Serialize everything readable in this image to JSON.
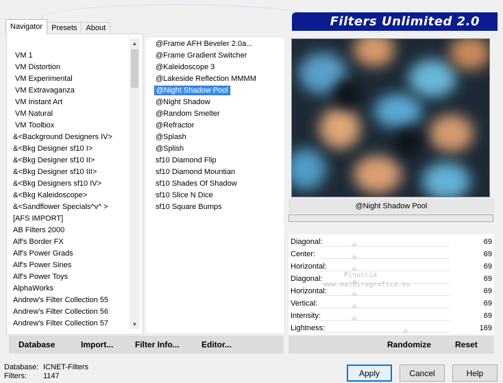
{
  "tabs": [
    {
      "label": "Navigator",
      "active": true
    },
    {
      "label": "Presets",
      "active": false
    },
    {
      "label": "About",
      "active": false
    }
  ],
  "banner_title": "Filters Unlimited 2.0",
  "categories": [
    "VM 1",
    "VM Distortion",
    "VM Experimental",
    "VM Extravaganza",
    "VM Instant Art",
    "VM Natural",
    "VM Toolbox",
    "&<Background Designers IV>",
    "&<Bkg Designer sf10 I>",
    "&<Bkg Designer sf10 II>",
    "&<Bkg Designer sf10 III>",
    "&<Bkg Designers sf10 IV>",
    "&<Bkg Kaleidoscope>",
    "&<Sandflower Specials^v^ >",
    "[AFS IMPORT]",
    "AB Filters 2000",
    "Alf's Border FX",
    "Alf's Power Grads",
    "Alf's Power Sines",
    "Alf's Power Toys",
    "AlphaWorks",
    "Andrew's Filter Collection 55",
    "Andrew's Filter Collection 56",
    "Andrew's Filter Collection 57"
  ],
  "filters": [
    "@Frame AFH Beveler 2.0a...",
    "@Frame Gradient Switcher",
    "@Kaleidoscope 3",
    "@Lakeside Reflection MMMM",
    "@Night Shadow Pool",
    "@Night Shadow",
    "@Random Smelter",
    "@Refractor",
    "@Splash",
    "@Splish",
    "sf10 Diamond Flip",
    "sf10 Diamond Mountian",
    "sf10 Shades Of Shadow",
    "sf10 Slice N Dice",
    "sf10 Square Bumps"
  ],
  "selected_filter_index": 4,
  "selected_filter_name": "@Night Shadow Pool",
  "params": [
    {
      "label": "Diagonal:",
      "value": "69"
    },
    {
      "label": "Center:",
      "value": "69"
    },
    {
      "label": "Horizontal:",
      "value": "69"
    },
    {
      "label": "Diagonal:",
      "value": "69"
    },
    {
      "label": "Horizontal:",
      "value": "69"
    },
    {
      "label": "Vertical:",
      "value": "69"
    },
    {
      "label": "Intensity:",
      "value": "69"
    },
    {
      "label": "Lightness:",
      "value": "169"
    }
  ],
  "bottom_buttons": {
    "database": "Database",
    "import": "Import...",
    "filter_info": "Filter Info...",
    "editor": "Editor...",
    "randomize": "Randomize",
    "reset": "Reset"
  },
  "status": {
    "database_label": "Database:",
    "database_value": "ICNET-Filters",
    "filters_label": "Filters:",
    "filters_value": "1147"
  },
  "dialog_buttons": {
    "apply": "Apply",
    "cancel": "Cancel",
    "help": "Help"
  },
  "watermark": [
    "Pinuccia",
    "www.maldiragrafica.eu"
  ],
  "colors": {
    "banner": "#0b1c8f",
    "selection": "#3b8df0",
    "default_button_border": "#0078d7"
  }
}
